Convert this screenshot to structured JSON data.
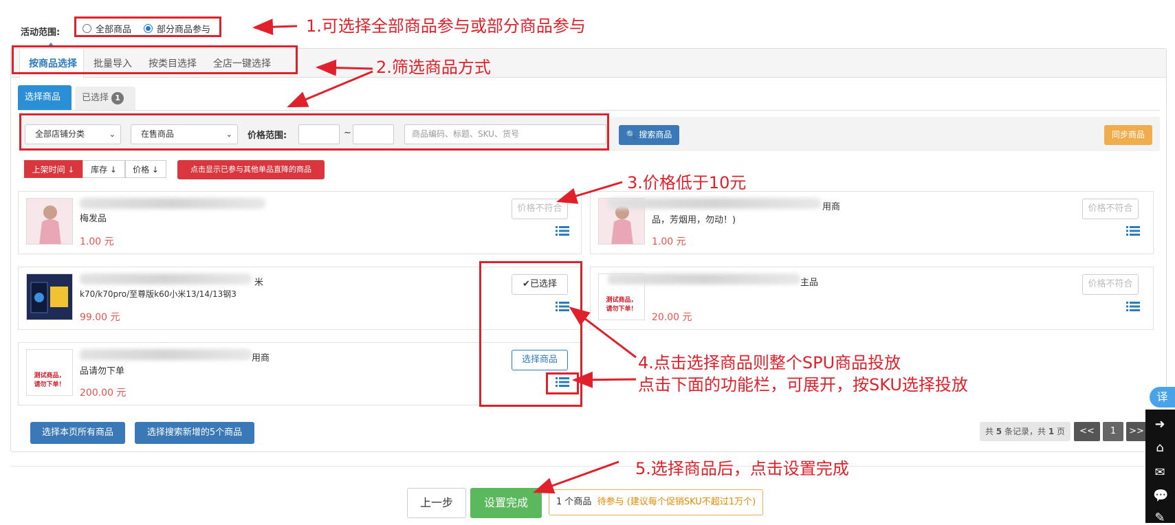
{
  "scope": {
    "label": "活动范围:",
    "options": [
      "全部商品",
      "部分商品参与"
    ],
    "selected_index": 1
  },
  "tabs": [
    "按商品选择",
    "批量导入",
    "按类目选择",
    "全店一键选择"
  ],
  "subtabs": {
    "select": "选择商品",
    "selected": "已选择",
    "selected_count": "1"
  },
  "filters": {
    "category": "全部店铺分类",
    "status": "在售商品",
    "price_label": "价格范围:",
    "tilde": "~",
    "search_placeholder": "商品编码、标题、SKU、货号",
    "search_button": "搜索商品",
    "sync_button": "同步商品"
  },
  "sort": {
    "buttons": [
      "上架时间 ↓",
      "库存 ↓",
      "价格 ↓"
    ],
    "show_other": "点击显示已参与其他单品直降的商品"
  },
  "products": [
    {
      "line1": "",
      "line2": "梅发品",
      "price": "1.00 元",
      "action": "价格不符合",
      "thumb": "pink-dress"
    },
    {
      "line1": "用商",
      "line2": "品，芳烟用，勿动！)",
      "price": "1.00 元",
      "action": "价格不符合",
      "thumb": "pink-dress"
    },
    {
      "line1": "米",
      "line2": "k70/k70pro/至尊版k60小米13/14/13钢3",
      "price": "99.00 元",
      "action": "✔已选择",
      "thumb": "phone-box"
    },
    {
      "line1": "主品",
      "line2": "",
      "price": "20.00 元",
      "action": "价格不符合",
      "thumb": "test-product"
    },
    {
      "line1": "用商",
      "line2": "品请勿下单",
      "price": "200.00 元",
      "action": "选择商品",
      "thumb": "test-product"
    }
  ],
  "test_product_text": [
    "测试商品，",
    "请勿下单！"
  ],
  "bottom": {
    "select_page": "选择本页所有商品",
    "select_new": "选择搜索新增的5个商品",
    "summary_pre": "共",
    "summary_count": "5",
    "summary_mid": "条记录，共",
    "summary_pages": "1",
    "summary_post": "页",
    "prev": "<<",
    "page": "1",
    "next": ">>"
  },
  "footer": {
    "prev_step": "上一步",
    "finish": "设置完成",
    "status_count": "1 个商品",
    "status_text": "待参与 (建议每个促销SKU不超过1万个)"
  },
  "annotations": [
    "1.可选择全部商品参与或部分商品参与",
    "2.筛选商品方式",
    "3.价格低于10元",
    "4.点击选择商品则整个SPU商品投放",
    "点击下面的功能栏，可展开，按SKU选择投放",
    "5.选择商品后，点击设置完成"
  ],
  "translate_badge": "译",
  "colors": {
    "accent": "#2b7bbf",
    "annotation": "#e0202a",
    "finish": "#5cb85c",
    "price": "#e5534b"
  }
}
